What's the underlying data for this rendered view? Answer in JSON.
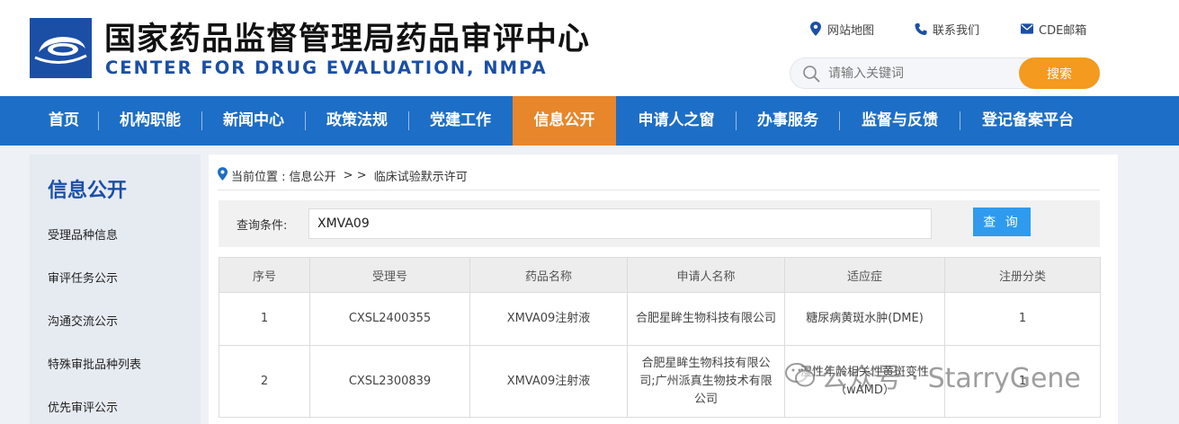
{
  "header": {
    "title_cn": "国家药品监督管理局药品审评中心",
    "title_en": "CENTER FOR DRUG EVALUATION, NMPA",
    "links": [
      {
        "label": "网站地图",
        "icon": "location-pin-icon"
      },
      {
        "label": "联系我们",
        "icon": "phone-icon"
      },
      {
        "label": "CDE邮箱",
        "icon": "mail-icon"
      }
    ],
    "search": {
      "placeholder": "请输入关键词",
      "button": "搜索"
    }
  },
  "nav": {
    "items": [
      "首页",
      "机构职能",
      "新闻中心",
      "政策法规",
      "党建工作",
      "信息公开",
      "申请人之窗",
      "办事服务",
      "监督与反馈",
      "登记备案平台"
    ],
    "active": "信息公开"
  },
  "sidebar": {
    "title": "信息公开",
    "items": [
      "受理品种信息",
      "审评任务公示",
      "沟通交流公示",
      "特殊审批品种列表",
      "优先审评公示"
    ]
  },
  "breadcrumb": {
    "prefix": "当前位置 : ",
    "section": "信息公开",
    "separator": " > > ",
    "current": "临床试验默示许可"
  },
  "query": {
    "label": "查询条件:",
    "value": "XMVA09",
    "button": "查 询"
  },
  "table": {
    "headers": [
      "序号",
      "受理号",
      "药品名称",
      "申请人名称",
      "适应症",
      "注册分类"
    ],
    "rows": [
      {
        "no": "1",
        "acceptance_no": "CXSL2400355",
        "drug_name": "XMVA09注射液",
        "applicant": "合肥星眸生物科技有限公司",
        "indication": "糖尿病黄斑水肿(DME)",
        "category": "1"
      },
      {
        "no": "2",
        "acceptance_no": "CXSL2300839",
        "drug_name": "XMVA09注射液",
        "applicant": "合肥星眸生物科技有限公司;广州派真生物技术有限公司",
        "indication": "湿性年龄相关性黄斑变性（wAMD）",
        "category": "1"
      }
    ]
  },
  "watermark": {
    "text": "公众号 · StarryGene"
  },
  "colors": {
    "brand_blue": "#1b4fa6",
    "nav_blue": "#1d6ec6",
    "nav_active": "#e8862b",
    "search_button": "#f39a1f",
    "query_button": "#2e9bef"
  }
}
